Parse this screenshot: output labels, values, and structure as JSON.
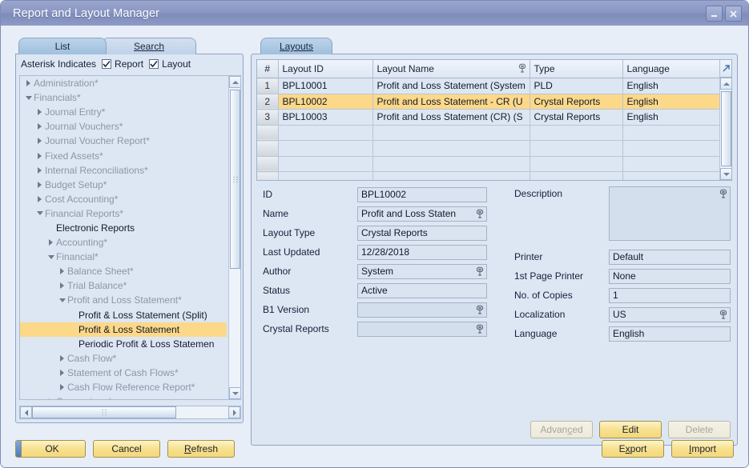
{
  "window": {
    "title": "Report and Layout Manager",
    "minimize_label": "minimize-icon",
    "close_label": "close-icon"
  },
  "left": {
    "tabs": [
      {
        "label": "List",
        "active": true
      },
      {
        "label": "Search",
        "active": false,
        "accel": "S"
      }
    ],
    "asterisk_label": "Asterisk Indicates",
    "checkboxes": [
      {
        "label": "Report",
        "checked": true,
        "accel": "p"
      },
      {
        "label": "Layout",
        "checked": true,
        "accel": "L"
      }
    ],
    "tree": [
      {
        "label": "Administration*",
        "depth": 0,
        "state": "collapsed",
        "selected": false
      },
      {
        "label": "Financials*",
        "depth": 0,
        "state": "expanded",
        "selected": false
      },
      {
        "label": "Journal Entry*",
        "depth": 1,
        "state": "collapsed",
        "selected": false
      },
      {
        "label": "Journal Vouchers*",
        "depth": 1,
        "state": "collapsed",
        "selected": false
      },
      {
        "label": "Journal Voucher Report*",
        "depth": 1,
        "state": "collapsed",
        "selected": false
      },
      {
        "label": "Fixed Assets*",
        "depth": 1,
        "state": "collapsed",
        "selected": false
      },
      {
        "label": "Internal Reconciliations*",
        "depth": 1,
        "state": "collapsed",
        "selected": false
      },
      {
        "label": "Budget Setup*",
        "depth": 1,
        "state": "collapsed",
        "selected": false
      },
      {
        "label": "Cost Accounting*",
        "depth": 1,
        "state": "collapsed",
        "selected": false
      },
      {
        "label": "Financial Reports*",
        "depth": 1,
        "state": "expanded",
        "selected": false
      },
      {
        "label": "Electronic Reports",
        "depth": 2,
        "state": "leaf",
        "selected": false
      },
      {
        "label": "Accounting*",
        "depth": 2,
        "state": "collapsed",
        "selected": false
      },
      {
        "label": "Financial*",
        "depth": 2,
        "state": "expanded",
        "selected": false
      },
      {
        "label": "Balance Sheet*",
        "depth": 3,
        "state": "collapsed",
        "selected": false
      },
      {
        "label": "Trial Balance*",
        "depth": 3,
        "state": "collapsed",
        "selected": false
      },
      {
        "label": "Profit and Loss Statement*",
        "depth": 3,
        "state": "expanded",
        "selected": false
      },
      {
        "label": "Profit & Loss Statement (Split)",
        "depth": 4,
        "state": "leaf",
        "selected": false
      },
      {
        "label": "Profit & Loss Statement",
        "depth": 4,
        "state": "leaf",
        "selected": true
      },
      {
        "label": "Periodic Profit & Loss Statemen",
        "depth": 4,
        "state": "leaf",
        "selected": false
      },
      {
        "label": "Cash Flow*",
        "depth": 3,
        "state": "collapsed",
        "selected": false
      },
      {
        "label": "Statement of Cash Flows*",
        "depth": 3,
        "state": "collapsed",
        "selected": false
      },
      {
        "label": "Cash Flow Reference Report*",
        "depth": 3,
        "state": "collapsed",
        "selected": false
      },
      {
        "label": "Comparison*",
        "depth": 2,
        "state": "collapsed",
        "selected": false
      }
    ]
  },
  "right": {
    "tabs": [
      {
        "label": "Layouts",
        "active": true,
        "accel": "y"
      }
    ],
    "grid": {
      "columns": [
        "#",
        "Layout ID",
        "Layout Name",
        "Type",
        "Language"
      ],
      "rows": [
        {
          "num": "1",
          "layout_id": "BPL10001",
          "layout_name": "Profit and Loss Statement (System",
          "type": "PLD",
          "language": "English",
          "selected": false
        },
        {
          "num": "2",
          "layout_id": "BPL10002",
          "layout_name": "Profit and Loss Statement - CR (U",
          "type": "Crystal Reports",
          "language": "English",
          "selected": true
        },
        {
          "num": "3",
          "layout_id": "BPL10003",
          "layout_name": "Profit and Loss Statement (CR) (S",
          "type": "Crystal Reports",
          "language": "English",
          "selected": false
        },
        {
          "num": "",
          "layout_id": "",
          "layout_name": "",
          "type": "",
          "language": "",
          "selected": false
        },
        {
          "num": "",
          "layout_id": "",
          "layout_name": "",
          "type": "",
          "language": "",
          "selected": false
        },
        {
          "num": "",
          "layout_id": "",
          "layout_name": "",
          "type": "",
          "language": "",
          "selected": false
        },
        {
          "num": "",
          "layout_id": "",
          "layout_name": "",
          "type": "",
          "language": "",
          "selected": false
        }
      ]
    },
    "form_left": [
      {
        "label": "ID",
        "value": "BPL10002",
        "link": false,
        "empty": false
      },
      {
        "label": "Name",
        "value": "Profit and Loss Staten",
        "link": true,
        "empty": false
      },
      {
        "label": "Layout Type",
        "value": "Crystal Reports",
        "link": false,
        "empty": false
      },
      {
        "label": "Last Updated",
        "value": "12/28/2018",
        "link": false,
        "empty": false
      },
      {
        "label": "Author",
        "value": "System",
        "link": true,
        "empty": false
      },
      {
        "label": "Status",
        "value": "Active",
        "link": false,
        "empty": false
      },
      {
        "label": "B1 Version",
        "value": "",
        "link": true,
        "empty": true
      },
      {
        "label": "Crystal Reports",
        "value": "",
        "link": true,
        "empty": true
      }
    ],
    "description": {
      "label": "Description",
      "value": "",
      "link": true
    },
    "form_right": [
      {
        "label": "Printer",
        "value": "Default",
        "link": false,
        "empty": false
      },
      {
        "label": "1st Page Printer",
        "value": "None",
        "link": false,
        "empty": false
      },
      {
        "label": "No. of Copies",
        "value": "1",
        "link": false,
        "empty": false
      },
      {
        "label": "Localization",
        "value": "US",
        "link": true,
        "empty": false
      },
      {
        "label": "Language",
        "value": "English",
        "link": false,
        "empty": false
      }
    ],
    "detail_buttons": [
      {
        "label": "Advanced",
        "accel": "c",
        "enabled": false
      },
      {
        "label": "Edit",
        "accel": "",
        "enabled": true
      },
      {
        "label": "Delete",
        "accel": "",
        "enabled": false
      }
    ]
  },
  "footer": {
    "left_buttons": [
      {
        "label": "OK",
        "accel": "",
        "default": true
      },
      {
        "label": "Cancel",
        "accel": "",
        "default": false
      },
      {
        "label": "Refresh",
        "accel": "R",
        "default": false
      }
    ],
    "right_buttons": [
      {
        "label": "Export",
        "accel": "x"
      },
      {
        "label": "Import",
        "accel": "I"
      }
    ]
  },
  "colors": {
    "titlebar": "#8b98c4",
    "selection": "#fcd889",
    "panel_bg": "#dde6f3",
    "window_bg": "#e7eef8",
    "button": "#f7e08e",
    "default_marker": "#4c79bd"
  }
}
